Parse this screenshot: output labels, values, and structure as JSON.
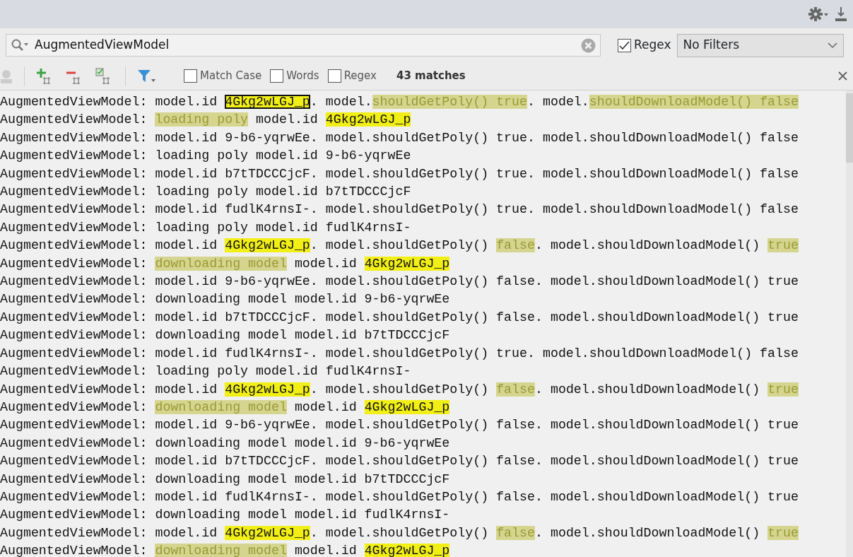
{
  "search": {
    "value": "AugmentedViewModel",
    "regex_checked": true,
    "regex_label": "Regex",
    "filter": "No Filters"
  },
  "find_bar": {
    "options": [
      {
        "label": "Match Case",
        "checked": false
      },
      {
        "label": "Words",
        "checked": false
      },
      {
        "label": "Regex",
        "checked": false
      }
    ],
    "match_count": "43 matches"
  },
  "log_lines": [
    [
      {
        "text": "AugmentedViewModel: model.id ",
        "kind": "plain"
      },
      {
        "text": "4Gkg2wLGJ_p",
        "kind": "current"
      },
      {
        "text": ". model.",
        "kind": "plain"
      },
      {
        "text": "shouldGetPoly() true",
        "kind": "context"
      },
      {
        "text": ". model.",
        "kind": "plain"
      },
      {
        "text": "shouldDownloadModel() false",
        "kind": "context"
      }
    ],
    [
      {
        "text": "AugmentedViewModel: ",
        "kind": "plain"
      },
      {
        "text": "loading poly",
        "kind": "context"
      },
      {
        "text": " model.id ",
        "kind": "plain"
      },
      {
        "text": "4Gkg2wLGJ_p",
        "kind": "match"
      }
    ],
    [
      {
        "text": "AugmentedViewModel: model.id 9-b6-yqrwEe. model.shouldGetPoly() true. model.shouldDownloadModel() false",
        "kind": "plain"
      }
    ],
    [
      {
        "text": "AugmentedViewModel: loading poly model.id 9-b6-yqrwEe",
        "kind": "plain"
      }
    ],
    [
      {
        "text": "AugmentedViewModel: model.id b7tTDCCCjcF. model.shouldGetPoly() true. model.shouldDownloadModel() false",
        "kind": "plain"
      }
    ],
    [
      {
        "text": "AugmentedViewModel: loading poly model.id b7tTDCCCjcF",
        "kind": "plain"
      }
    ],
    [
      {
        "text": "AugmentedViewModel: model.id fudlK4rnsI-. model.shouldGetPoly() true. model.shouldDownloadModel() false",
        "kind": "plain"
      }
    ],
    [
      {
        "text": "AugmentedViewModel: loading poly model.id fudlK4rnsI-",
        "kind": "plain"
      }
    ],
    [
      {
        "text": "AugmentedViewModel: model.id ",
        "kind": "plain"
      },
      {
        "text": "4Gkg2wLGJ_p",
        "kind": "match"
      },
      {
        "text": ". model.shouldGetPoly() ",
        "kind": "plain"
      },
      {
        "text": "false",
        "kind": "context"
      },
      {
        "text": ". model.shouldDownloadModel() ",
        "kind": "plain"
      },
      {
        "text": "true",
        "kind": "context"
      }
    ],
    [
      {
        "text": "AugmentedViewModel: ",
        "kind": "plain"
      },
      {
        "text": "downloading model",
        "kind": "context"
      },
      {
        "text": " model.id ",
        "kind": "plain"
      },
      {
        "text": "4Gkg2wLGJ_p",
        "kind": "match"
      }
    ],
    [
      {
        "text": "AugmentedViewModel: model.id 9-b6-yqrwEe. model.shouldGetPoly() false. model.shouldDownloadModel() true",
        "kind": "plain"
      }
    ],
    [
      {
        "text": "AugmentedViewModel: downloading model model.id 9-b6-yqrwEe",
        "kind": "plain"
      }
    ],
    [
      {
        "text": "AugmentedViewModel: model.id b7tTDCCCjcF. model.shouldGetPoly() false. model.shouldDownloadModel() true",
        "kind": "plain"
      }
    ],
    [
      {
        "text": "AugmentedViewModel: downloading model model.id b7tTDCCCjcF",
        "kind": "plain"
      }
    ],
    [
      {
        "text": "AugmentedViewModel: model.id fudlK4rnsI-. model.shouldGetPoly() true. model.shouldDownloadModel() false",
        "kind": "plain"
      }
    ],
    [
      {
        "text": "AugmentedViewModel: loading poly model.id fudlK4rnsI-",
        "kind": "plain"
      }
    ],
    [
      {
        "text": "AugmentedViewModel: model.id ",
        "kind": "plain"
      },
      {
        "text": "4Gkg2wLGJ_p",
        "kind": "match"
      },
      {
        "text": ". model.shouldGetPoly() ",
        "kind": "plain"
      },
      {
        "text": "false",
        "kind": "context"
      },
      {
        "text": ". model.shouldDownloadModel() ",
        "kind": "plain"
      },
      {
        "text": "true",
        "kind": "context"
      }
    ],
    [
      {
        "text": "AugmentedViewModel: ",
        "kind": "plain"
      },
      {
        "text": "downloading model",
        "kind": "context"
      },
      {
        "text": " model.id ",
        "kind": "plain"
      },
      {
        "text": "4Gkg2wLGJ_p",
        "kind": "match"
      }
    ],
    [
      {
        "text": "AugmentedViewModel: model.id 9-b6-yqrwEe. model.shouldGetPoly() false. model.shouldDownloadModel() true",
        "kind": "plain"
      }
    ],
    [
      {
        "text": "AugmentedViewModel: downloading model model.id 9-b6-yqrwEe",
        "kind": "plain"
      }
    ],
    [
      {
        "text": "AugmentedViewModel: model.id b7tTDCCCjcF. model.shouldGetPoly() false. model.shouldDownloadModel() true",
        "kind": "plain"
      }
    ],
    [
      {
        "text": "AugmentedViewModel: downloading model model.id b7tTDCCCjcF",
        "kind": "plain"
      }
    ],
    [
      {
        "text": "AugmentedViewModel: model.id fudlK4rnsI-. model.shouldGetPoly() false. model.shouldDownloadModel() true",
        "kind": "plain"
      }
    ],
    [
      {
        "text": "AugmentedViewModel: downloading model model.id fudlK4rnsI-",
        "kind": "plain"
      }
    ],
    [
      {
        "text": "AugmentedViewModel: model.id ",
        "kind": "plain"
      },
      {
        "text": "4Gkg2wLGJ_p",
        "kind": "match"
      },
      {
        "text": ". model.shouldGetPoly() ",
        "kind": "plain"
      },
      {
        "text": "false",
        "kind": "context"
      },
      {
        "text": ". model.shouldDownloadModel() ",
        "kind": "plain"
      },
      {
        "text": "true",
        "kind": "context"
      }
    ],
    [
      {
        "text": "AugmentedViewModel: ",
        "kind": "plain"
      },
      {
        "text": "downloading model",
        "kind": "context"
      },
      {
        "text": " model.id ",
        "kind": "plain"
      },
      {
        "text": "4Gkg2wLGJ_p",
        "kind": "match"
      }
    ]
  ]
}
